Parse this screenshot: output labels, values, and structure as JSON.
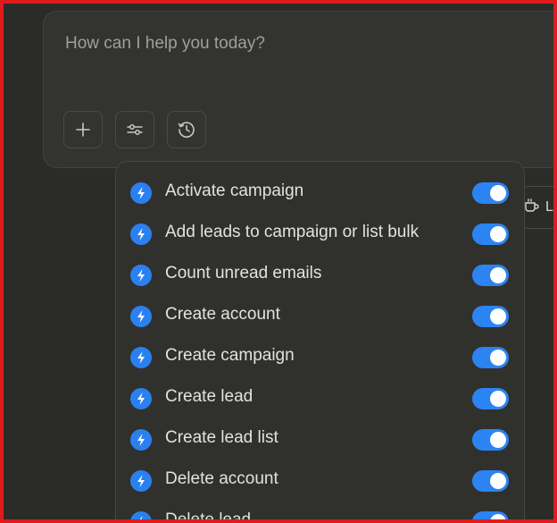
{
  "prompt": {
    "placeholder": "How can I help you today?"
  },
  "toolbar": {
    "buttons": [
      {
        "icon": "plus-icon"
      },
      {
        "icon": "sliders-icon"
      },
      {
        "icon": "clock-history-icon"
      }
    ]
  },
  "side_chip": {
    "icon": "cup-icon",
    "text": "Li"
  },
  "tools_menu": {
    "accent_color": "#2c84f2",
    "items": [
      {
        "label": "Activate campaign",
        "enabled": true
      },
      {
        "label": "Add leads to campaign or list bulk",
        "enabled": true
      },
      {
        "label": "Count unread emails",
        "enabled": true
      },
      {
        "label": "Create account",
        "enabled": true
      },
      {
        "label": "Create campaign",
        "enabled": true
      },
      {
        "label": "Create lead",
        "enabled": true
      },
      {
        "label": "Create lead list",
        "enabled": true
      },
      {
        "label": "Delete account",
        "enabled": true
      },
      {
        "label": "Delete lead",
        "enabled": true
      }
    ]
  }
}
